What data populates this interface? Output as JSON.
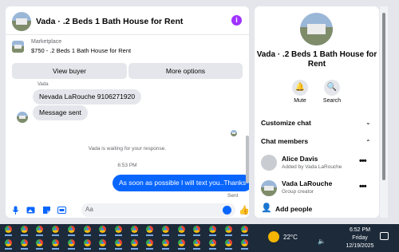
{
  "chat": {
    "title": "Vada · .2 Beds 1 Bath House for Rent",
    "marketplace_label": "Marketplace",
    "marketplace_item": "$750 - .2 Beds 1 Bath House for Rent",
    "view_buyer": "View buyer",
    "more_options": "More options",
    "sender_name": "Vada",
    "messages_in": [
      "Nevada LaRouche 9106271920",
      "Message sent"
    ],
    "waiting_notice": "Vada is waiting for your response.",
    "timestamp": "6:53 PM",
    "message_out": "As soon as possible I will text you..Thanks",
    "status": "Sent",
    "placeholder": "Aa"
  },
  "panel": {
    "title": "Vada · .2 Beds 1 Bath House for Rent",
    "mute": "Mute",
    "search": "Search",
    "customize_chat": "Customize chat",
    "chat_members": "Chat members",
    "members": [
      {
        "name": "Alice Davis",
        "sub": "Added by Vada LaRouche"
      },
      {
        "name": "Vada LaRouche",
        "sub": "Group creator"
      }
    ],
    "add_people": "Add people"
  },
  "taskbar": {
    "temperature": "22°C",
    "time": "6:52 PM",
    "day": "Friday",
    "date": "12/19/2025"
  }
}
